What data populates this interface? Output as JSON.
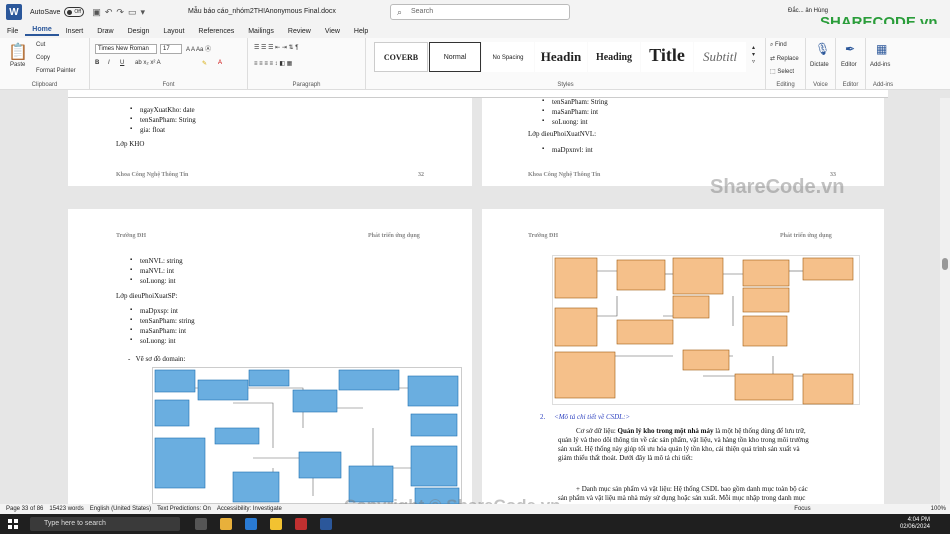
{
  "titlebar": {
    "autosave": "AutoSave",
    "toggle": "Off",
    "title": "Mẫu báo cáo_nhóm2TH!Anonymous Final.docx",
    "search_placeholder": "Search",
    "user": "Đắc... ân Hùng"
  },
  "menu": [
    "File",
    "Home",
    "Insert",
    "Draw",
    "Design",
    "Layout",
    "References",
    "Mailings",
    "Review",
    "View",
    "Help"
  ],
  "ribbon": {
    "clipboard": {
      "paste": "Paste",
      "cut": "Cut",
      "copy": "Copy",
      "format_painter": "Format Painter",
      "label": "Clipboard"
    },
    "font": {
      "name": "Times New Roman",
      "size": "17",
      "label": "Font"
    },
    "paragraph": {
      "label": "Paragraph"
    },
    "styles": {
      "items": [
        "COVERB",
        "Normal",
        "No Spacing",
        "Headin",
        "Heading",
        "Title",
        "Subtitl"
      ],
      "label": "Styles"
    },
    "editing": {
      "find": "Find",
      "replace": "Replace",
      "select": "Select",
      "label": "Editing"
    },
    "voice": {
      "dictate": "Dictate",
      "label": "Voice"
    },
    "editor": {
      "editor": "Editor",
      "label": "Editor"
    },
    "addins": {
      "addins": "Add-ins",
      "label": "Add-ins"
    }
  },
  "pages": {
    "p32": {
      "items": [
        "ngayXuatKho: date",
        "tenSanPham: String",
        "gia: float"
      ],
      "heading": "Lớp KHO",
      "footer_left": "Khoa Công Nghệ Thông Tin",
      "footer_right": "32"
    },
    "p33": {
      "items": [
        "tenSanPham: String",
        "maSanPham: int",
        "soLuong: int"
      ],
      "heading": "Lớp dieuPhoiXuatNVL:",
      "items2": [
        "maDpxnvl: int"
      ],
      "footer_left": "Khoa Công Nghệ Thông Tin",
      "footer_right": "33"
    },
    "p34": {
      "header_left": "Trường ĐH",
      "header_right": "Phát triển ứng dụng",
      "items": [
        "tenNVL: string",
        "maNVL: int",
        "soLuong: int"
      ],
      "heading": "Lớp dieuPhoiXuatSP:",
      "items2": [
        "maDpxsp: int",
        "tenSanPham: string",
        "maSanPham: int",
        "soLuong: int"
      ],
      "diagram_title": "Vẽ sơ đồ domain:"
    },
    "p35": {
      "header_left": "Trường ĐH",
      "header_right": "Phát triển ứng dụng",
      "section_num": "2.",
      "section_title": "<Mô tả chi tiết về CSDL:>",
      "para1_a": "Cơ sở dữ liệu: ",
      "para1_b": "Quản lý kho trong một nhà máy",
      "para1_c": " là một hệ thống dùng để lưu trữ,",
      "para1_l2": "quản lý và theo dõi thông tin về các sản phẩm, vật liệu, và hàng tồn kho trong môi trường",
      "para1_l3": "sản xuất. Hệ thống này giúp tối ưu hóa quản lý tồn kho, cải thiện quá trình sản xuất và",
      "para1_l4": "giảm thiểu thất thoát. Dưới đây là mô tả chi tiết:",
      "para2_l1": "+ Danh mục sản phẩm và vật liệu: Hệ thống CSDL bao gồm danh mục toàn bộ các",
      "para2_l2": "sản phẩm và vật liệu mà nhà máy sử dụng hoặc sản xuất. Mỗi mục nhập trong danh mục"
    }
  },
  "status": {
    "page": "Page 33 of 86",
    "words": "15423 words",
    "lang": "English (United States)",
    "predictions": "Text Predictions: On",
    "access": "Accessibility: Investigate",
    "focus": "Focus",
    "zoom": "100%"
  },
  "taskbar": {
    "search": "Type here to search",
    "time": "4:04 PM",
    "date": "02/06/2024"
  },
  "watermark": {
    "center": "ShareCode.vn",
    "bottom": "Copyright © ShareCode.vn",
    "logo": "SHARECODE.vn"
  }
}
